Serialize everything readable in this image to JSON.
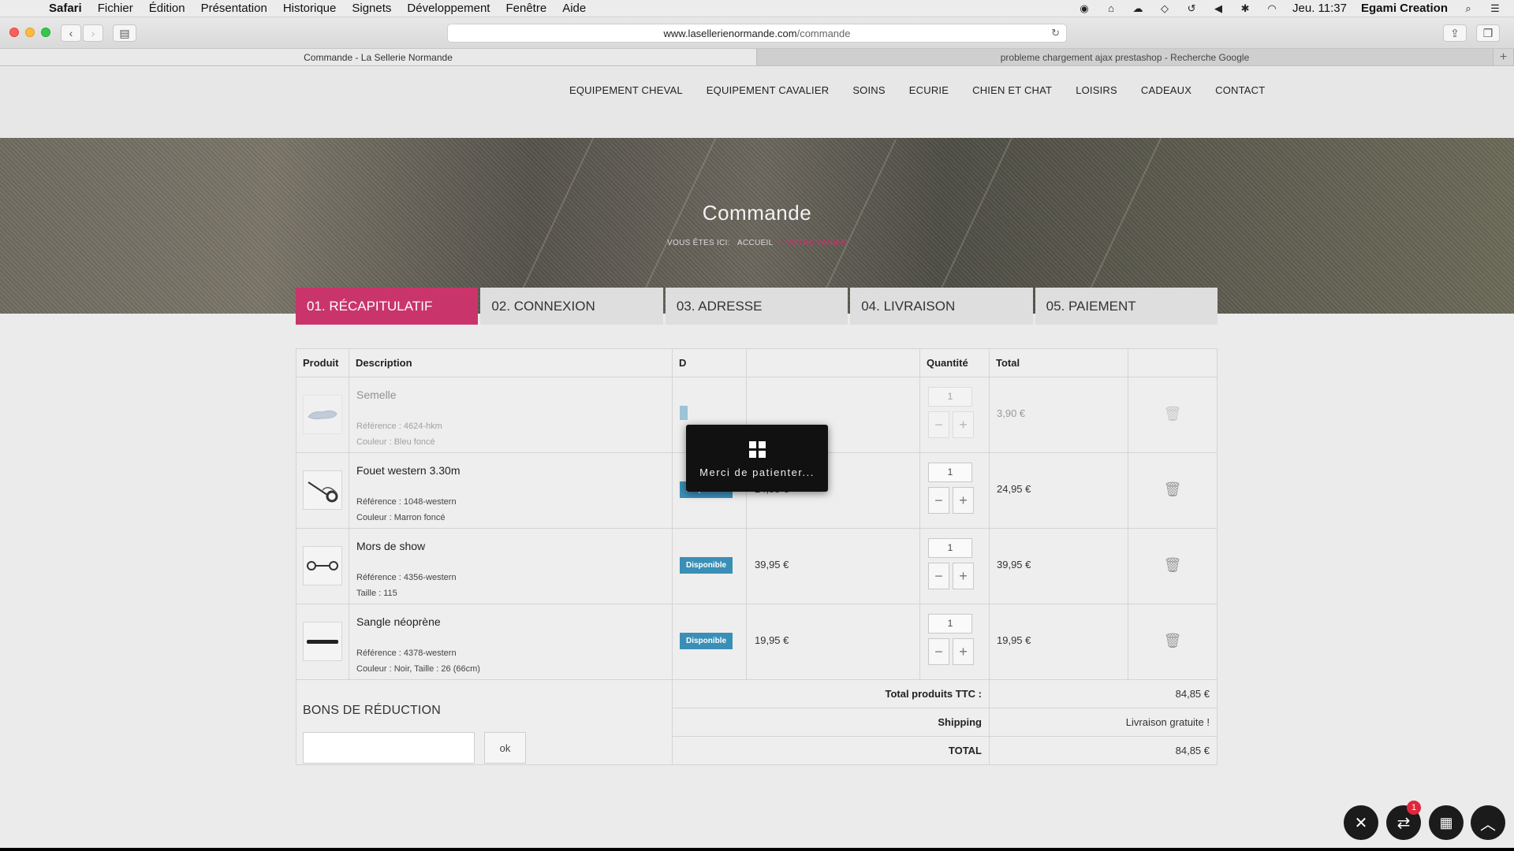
{
  "menubar": {
    "app_name": "Safari",
    "menus": [
      "Fichier",
      "Édition",
      "Présentation",
      "Historique",
      "Signets",
      "Développement",
      "Fenêtre",
      "Aide"
    ],
    "clock": "Jeu. 11:37",
    "user": "Egami Creation"
  },
  "browser": {
    "url_domain": "www.lasellerienormande.com",
    "url_path": "/commande",
    "tabs": [
      {
        "title": "Commande - La Sellerie Normande"
      },
      {
        "title": "probleme chargement ajax prestashop - Recherche Google"
      }
    ],
    "new_tab": "+"
  },
  "site_nav": [
    "EQUIPEMENT CHEVAL",
    "EQUIPEMENT CAVALIER",
    "SOINS",
    "ECURIE",
    "CHIEN ET CHAT",
    "LOISIRS",
    "CADEAUX",
    "CONTACT"
  ],
  "hero": {
    "title": "Commande",
    "breadcrumb_prefix": "VOUS ÊTES ICI:",
    "breadcrumb_home": "ACCUEIL",
    "breadcrumb_separator": ">",
    "breadcrumb_current": "VOTRE PANIER"
  },
  "steps": [
    "01. RÉCAPITULATIF",
    "02. CONNEXION",
    "03. ADRESSE",
    "04. LIVRAISON",
    "05. PAIEMENT"
  ],
  "cart": {
    "headers": {
      "product": "Produit",
      "description": "Description",
      "dispo": "D",
      "quantity": "Quantité",
      "total": "Total"
    },
    "items": [
      {
        "name": "Semelle",
        "ref": "Référence : 4624-hkm",
        "attr": "Couleur : Bleu foncé",
        "badge": "",
        "price": "",
        "qty": "1",
        "total": "3,90 €"
      },
      {
        "name": "Fouet western 3.30m",
        "ref": "Référence : 1048-western",
        "attr": "Couleur : Marron foncé",
        "badge": "Disponible",
        "price": "24,95 €",
        "qty": "1",
        "total": "24,95 €"
      },
      {
        "name": "Mors de show",
        "ref": "Référence : 4356-western",
        "attr": "Taille : 115",
        "badge": "Disponible",
        "price": "39,95 €",
        "qty": "1",
        "total": "39,95 €"
      },
      {
        "name": "Sangle néoprène",
        "ref": "Référence : 4378-western",
        "attr": "Couleur : Noir, Taille : 26 (66cm)",
        "badge": "Disponible",
        "price": "19,95 €",
        "qty": "1",
        "total": "19,95 €"
      }
    ],
    "summary": {
      "products_label": "Total produits TTC :",
      "products_value": "84,85 €",
      "shipping_label": "Shipping",
      "shipping_value": "Livraison gratuite !",
      "total_label": "TOTAL",
      "total_value": "84,85 €"
    },
    "coupon": {
      "title": "BONS DE RÉDUCTION",
      "button": "ok"
    }
  },
  "loader": {
    "message": "Merci de patienter..."
  },
  "fabs": {
    "notification_count": "1"
  },
  "colors": {
    "accent": "#c9356b",
    "badge": "#3a8fb7"
  }
}
